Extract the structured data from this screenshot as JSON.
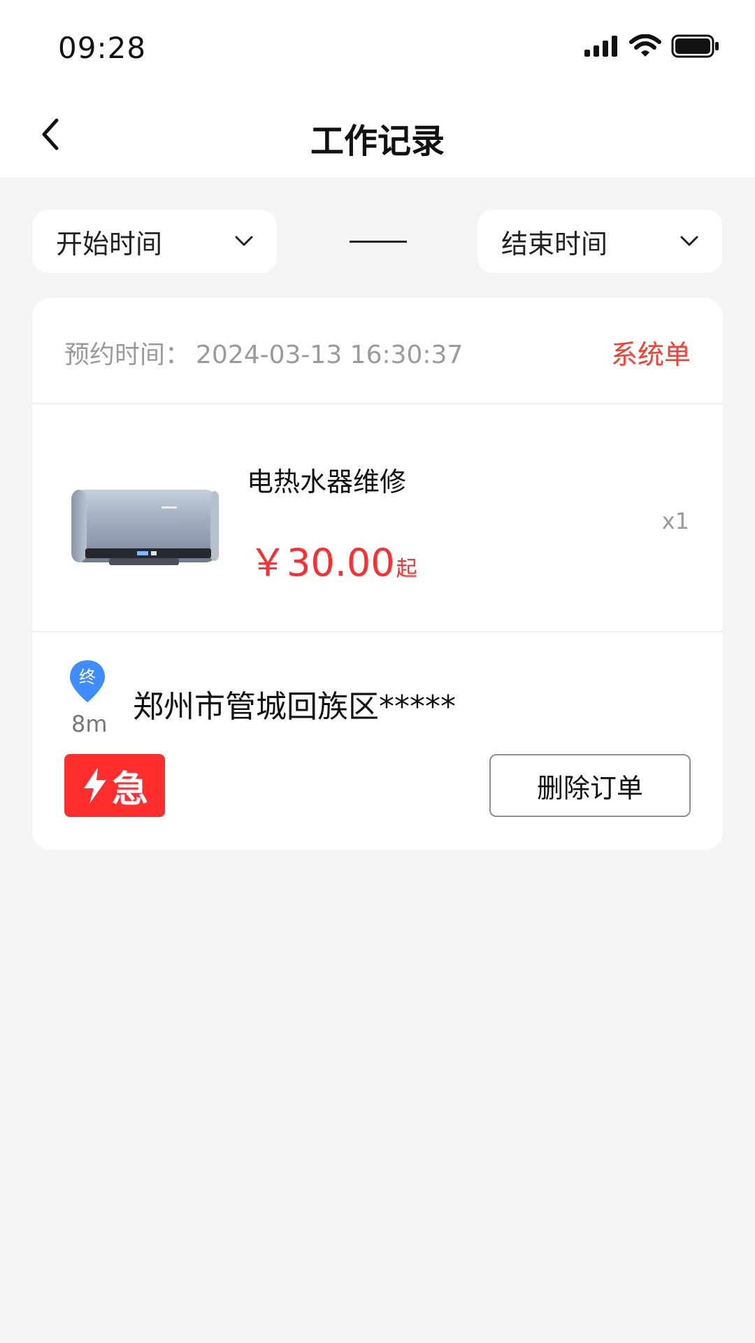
{
  "status_bar": {
    "time": "09:28",
    "icons": [
      "signal-icon",
      "wifi-icon",
      "battery-icon"
    ]
  },
  "header": {
    "back_icon": "chevron-left-icon",
    "title": "工作记录"
  },
  "filters": {
    "start_label": "开始时间",
    "end_label": "结束时间",
    "dropdown_icon": "chevron-down-icon"
  },
  "order": {
    "appointment_label": "预约时间：",
    "appointment_time": "2024-03-13 16:30:37",
    "order_type": "系统单",
    "product_name": "电热水器维修",
    "currency": "￥",
    "price": "30.00",
    "price_suffix": "起",
    "quantity": "x1",
    "pin_label": "终",
    "distance": "8m",
    "address": "郑州市管城回族区*****",
    "urgent_label": "急",
    "delete_label": "删除订单"
  },
  "colors": {
    "accent_red": "#ff2d2d",
    "pin_blue": "#3f8cff",
    "background": "#f4f4f4"
  }
}
